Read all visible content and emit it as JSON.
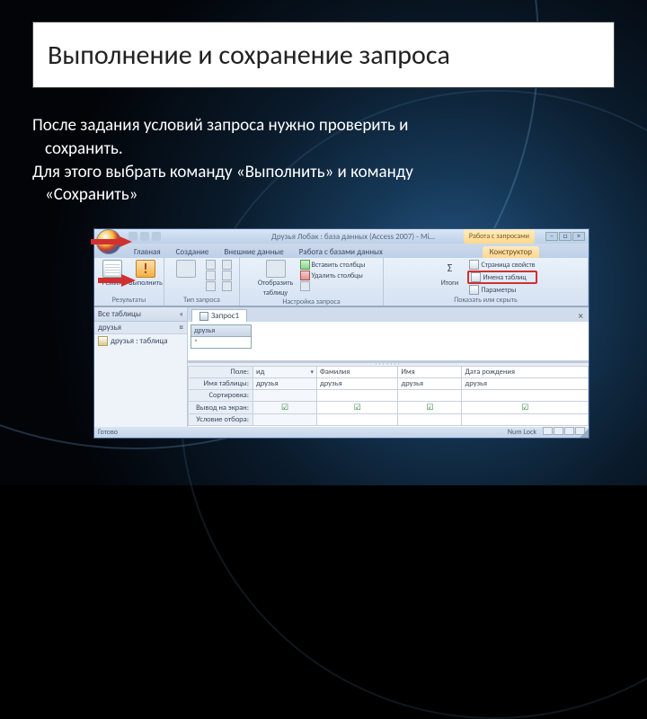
{
  "slide": {
    "title": "Выполнение и сохранение запроса",
    "body1": "После задания условий запроса нужно проверить и",
    "body2": "сохранить.",
    "body3": "Для этого выбрать команду «Выполнить» и команду",
    "body4": "«Сохранить»"
  },
  "app": {
    "title": "Друзья Лобак : база данных (Access 2007) - Mi…",
    "context_tab_header": "Работа с запросами",
    "tabs": [
      "Главная",
      "Создание",
      "Внешние данные",
      "Работа с базами данных"
    ],
    "context_tab": "Конструктор",
    "ribbon": {
      "group_results": "Результаты",
      "btn_view": "Режим",
      "btn_run": "Выполнить",
      "group_querytype": "Тип запроса",
      "group_querysetup": "Настройка запроса",
      "btn_showtable_l1": "Отобразить",
      "btn_showtable_l2": "таблицу",
      "btn_insert_col": "Вставить столбцы",
      "btn_delete_col": "Удалить столбцы",
      "btn_totals": "Итоги",
      "btn_propsheet": "Страница свойств",
      "btn_tablenames": "Имена таблиц",
      "btn_params": "Параметры",
      "group_showhide": "Показать или скрыть"
    },
    "nav": {
      "header": "Все таблицы",
      "chevrons": "«",
      "group": "друзья",
      "group_chev": "¤",
      "item": "друзья : таблица"
    },
    "doc": {
      "tab": "Запрос1",
      "table_title": "друзья",
      "table_field": "*"
    },
    "grid": {
      "row_field": "Поле:",
      "row_table": "Имя таблицы:",
      "row_sort": "Сортировка:",
      "row_show": "Вывод на экран:",
      "row_criteria": "Условие отбора:",
      "c1_field": "ид",
      "c1_table": "друзья",
      "c2_field": "Фамилия",
      "c2_table": "друзья",
      "c3_field": "Имя",
      "c3_table": "друзья",
      "c4_field": "Дата рождения",
      "c4_table": "друзья"
    },
    "status": {
      "left": "Готово",
      "numlock": "Num Lock"
    }
  }
}
